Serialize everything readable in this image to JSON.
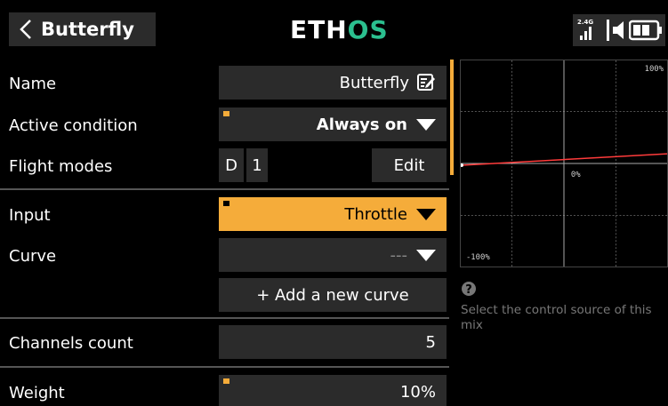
{
  "header": {
    "title": "Butterfly",
    "logo_part1": "ETH",
    "logo_part2": "OS",
    "radio_band": "2.4G"
  },
  "form": {
    "name": {
      "label": "Name",
      "value": "Butterfly"
    },
    "active_condition": {
      "label": "Active condition",
      "value": "Always on"
    },
    "flight_modes": {
      "label": "Flight modes",
      "mode_d": "D",
      "mode_1": "1",
      "edit_label": "Edit"
    },
    "input": {
      "label": "Input",
      "value": "Throttle"
    },
    "curve": {
      "label": "Curve",
      "value": "---"
    },
    "add_curve_label": "+ Add a new curve",
    "channels_count": {
      "label": "Channels count",
      "value": "5"
    },
    "weight": {
      "label": "Weight",
      "value": "10%"
    }
  },
  "graph": {
    "label_top": "100%",
    "label_mid": "0%",
    "label_bottom": "-100%",
    "line_color": "#ff3b3b"
  },
  "help": {
    "text": "Select the control source of this mix"
  },
  "colors": {
    "accent": "#f5ac3a",
    "field_bg": "#2b2b2b",
    "logo_accent": "#2bbf8f"
  }
}
